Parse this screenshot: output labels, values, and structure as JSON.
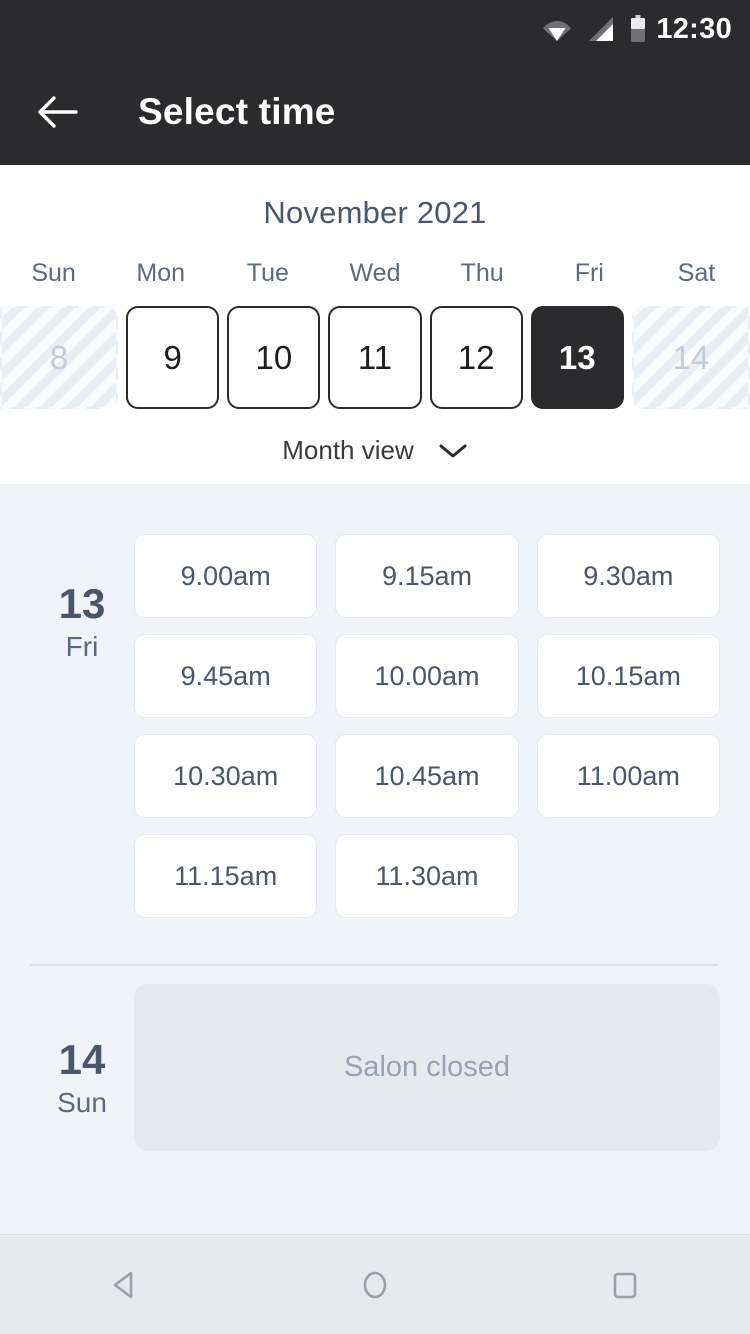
{
  "statusbar": {
    "time": "12:30",
    "icons": [
      "wifi-icon",
      "signal-icon",
      "battery-icon"
    ]
  },
  "appbar": {
    "back_icon": "arrow-left-icon",
    "title": "Select time"
  },
  "calendar": {
    "month_title": "November 2021",
    "weekdays": [
      "Sun",
      "Mon",
      "Tue",
      "Wed",
      "Thu",
      "Fri",
      "Sat"
    ],
    "days": [
      {
        "num": "8",
        "state": "disabled"
      },
      {
        "num": "9",
        "state": "enabled"
      },
      {
        "num": "10",
        "state": "enabled"
      },
      {
        "num": "11",
        "state": "enabled"
      },
      {
        "num": "12",
        "state": "enabled"
      },
      {
        "num": "13",
        "state": "selected"
      },
      {
        "num": "14",
        "state": "disabled"
      }
    ],
    "view_toggle": {
      "label": "Month view",
      "icon": "chevron-down-icon"
    }
  },
  "schedule": [
    {
      "day_num": "13",
      "day_dow": "Fri",
      "slots": [
        "9.00am",
        "9.15am",
        "9.30am",
        "9.45am",
        "10.00am",
        "10.15am",
        "10.30am",
        "10.45am",
        "11.00am",
        "11.15am",
        "11.30am"
      ]
    },
    {
      "day_num": "14",
      "day_dow": "Sun",
      "closed_message": "Salon closed"
    }
  ],
  "navbar": {
    "back": "nav-back-icon",
    "home": "nav-home-icon",
    "recents": "nav-recents-icon"
  },
  "colors": {
    "appbar_bg": "#2b2b2e",
    "page_bg": "#f0f3f8",
    "card_bg": "#ffffff",
    "text_slate": "#4b566b",
    "muted": "#97a2b4",
    "closed_panel": "#e6eaef",
    "navbar_bg": "#e7e9ec"
  }
}
